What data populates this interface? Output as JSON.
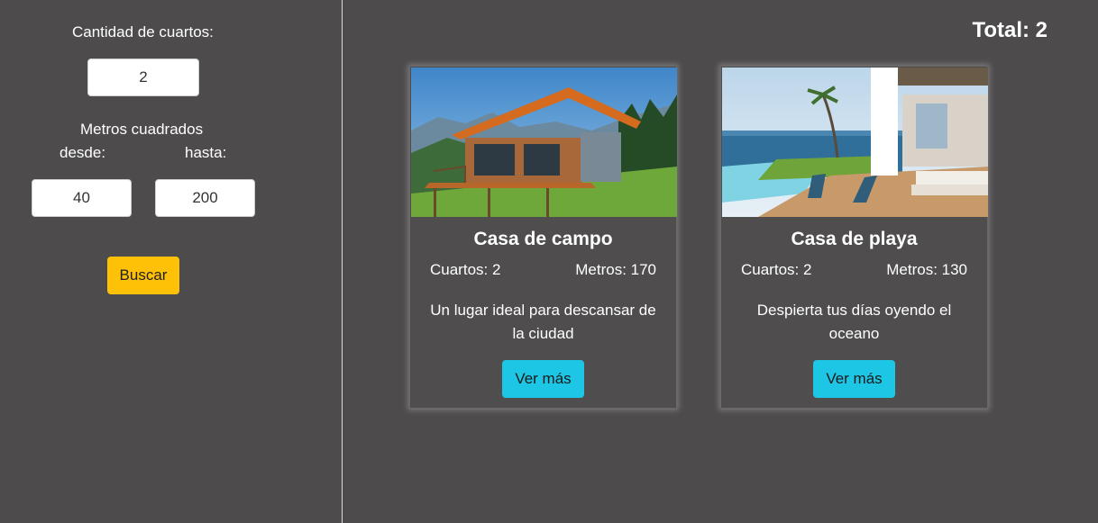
{
  "filters": {
    "rooms_label": "Cantidad de cuartos:",
    "rooms_value": "2",
    "meters_label": "Metros cuadrados",
    "from_label": "desde:",
    "to_label": "hasta:",
    "from_value": "40",
    "to_value": "200",
    "search_label": "Buscar"
  },
  "total_label": "Total: 2",
  "cards": [
    {
      "title": "Casa de campo",
      "rooms": "Cuartos: 2",
      "meters": "Metros: 170",
      "description": "Un lugar ideal para descansar de la ciudad",
      "button_label": "Ver más"
    },
    {
      "title": "Casa de playa",
      "rooms": "Cuartos: 2",
      "meters": "Metros: 130",
      "description": "Despierta tus días oyendo el oceano",
      "button_label": "Ver más"
    }
  ],
  "colors": {
    "background": "#4d4b4c",
    "search_button": "#ffc107",
    "more_button": "#1ec6e6"
  }
}
